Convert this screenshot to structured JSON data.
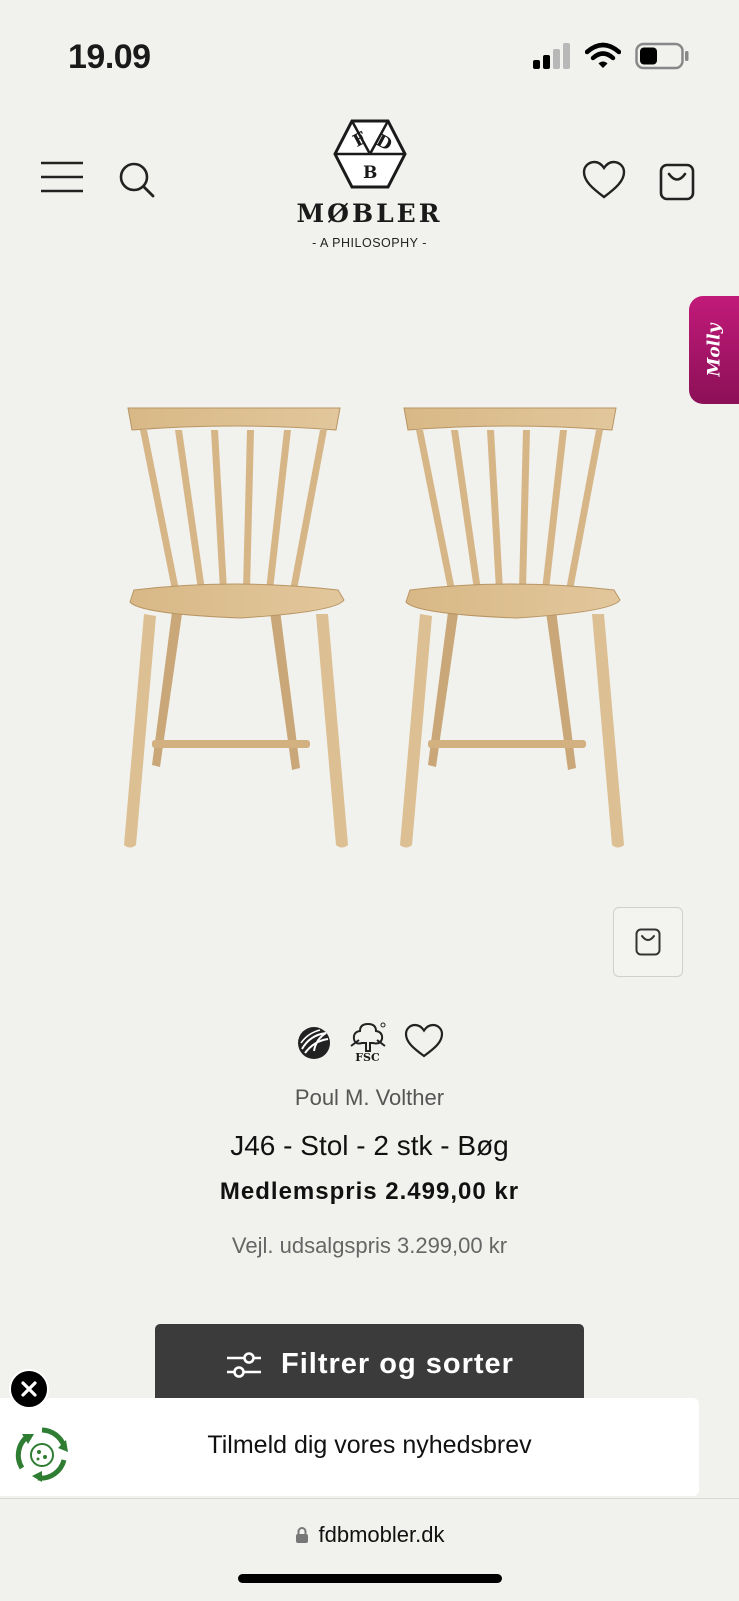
{
  "status_bar": {
    "time": "19.09"
  },
  "header": {
    "logo_letters": [
      "F",
      "D",
      "B"
    ],
    "brand": "MØBLER",
    "tagline": "- A PHILOSOPHY -",
    "menu_icon": "hamburger-icon",
    "search_icon": "search-icon",
    "wishlist_icon": "heart-icon",
    "cart_icon": "shopping-bag-icon"
  },
  "molly_tab": {
    "label": "Molly"
  },
  "product": {
    "designer": "Poul M. Volther",
    "name": "J46 - Stol - 2 stk - Bøg",
    "member_price": "Medlemspris 2.499,00 kr",
    "retail_price": "Vejl. udsalgspris 3.299,00 kr",
    "badges": {
      "swan_icon": "nordic-swan-ecolabel-icon",
      "fsc_label": "FSC",
      "heart_icon": "heart-icon"
    }
  },
  "filter_button": {
    "label": "Filtrer og sorter"
  },
  "newsletter": {
    "label": "Tilmeld dig vores nyhedsbrev"
  },
  "browser": {
    "url": "fdbmobler.dk"
  },
  "colors": {
    "background": "#f1f1ed",
    "filter_bg": "#3b3b3b",
    "molly_tab": "#b0166c",
    "wood": "#d9bb8f"
  }
}
